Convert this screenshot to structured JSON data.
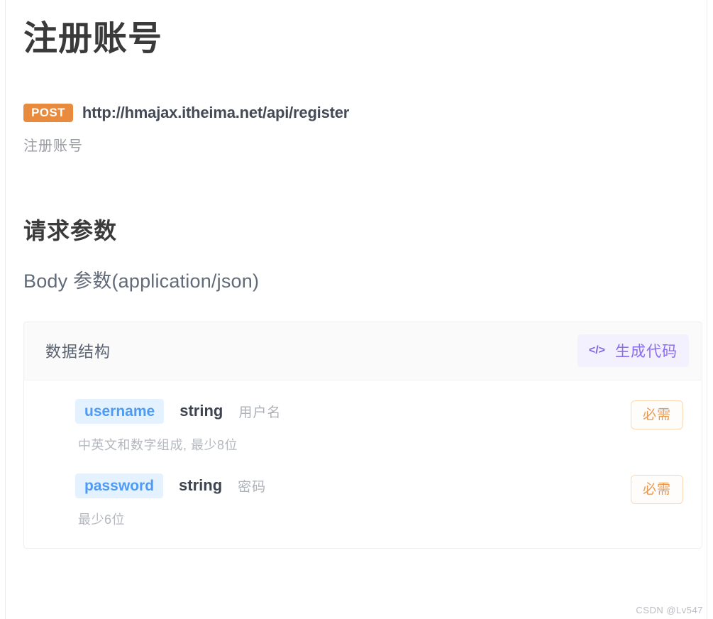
{
  "api": {
    "title": "注册账号",
    "method": "POST",
    "url": "http://hmajax.itheima.net/api/register",
    "description": "注册账号"
  },
  "request_section": {
    "heading": "请求参数",
    "subheading": "Body 参数(application/json)"
  },
  "params_panel": {
    "header_title": "数据结构",
    "generate_code": {
      "icon": "</>",
      "label": "生成代码"
    },
    "rows": [
      {
        "name": "username",
        "type": "string",
        "label": "用户名",
        "note": "中英文和数字组成, 最少8位",
        "required_badge": "必需"
      },
      {
        "name": "password",
        "type": "string",
        "label": "密码",
        "note": "最少6位",
        "required_badge": "必需"
      }
    ]
  },
  "watermark": "CSDN @Lv547",
  "colors": {
    "method_badge_bg": "#e98b3f",
    "param_chip_bg": "#e3f2fe",
    "param_chip_text": "#4d9bf6",
    "generate_code_accent": "#8b6ef0",
    "required_badge_text": "#e99a52",
    "required_badge_border": "#fbd9b6"
  }
}
